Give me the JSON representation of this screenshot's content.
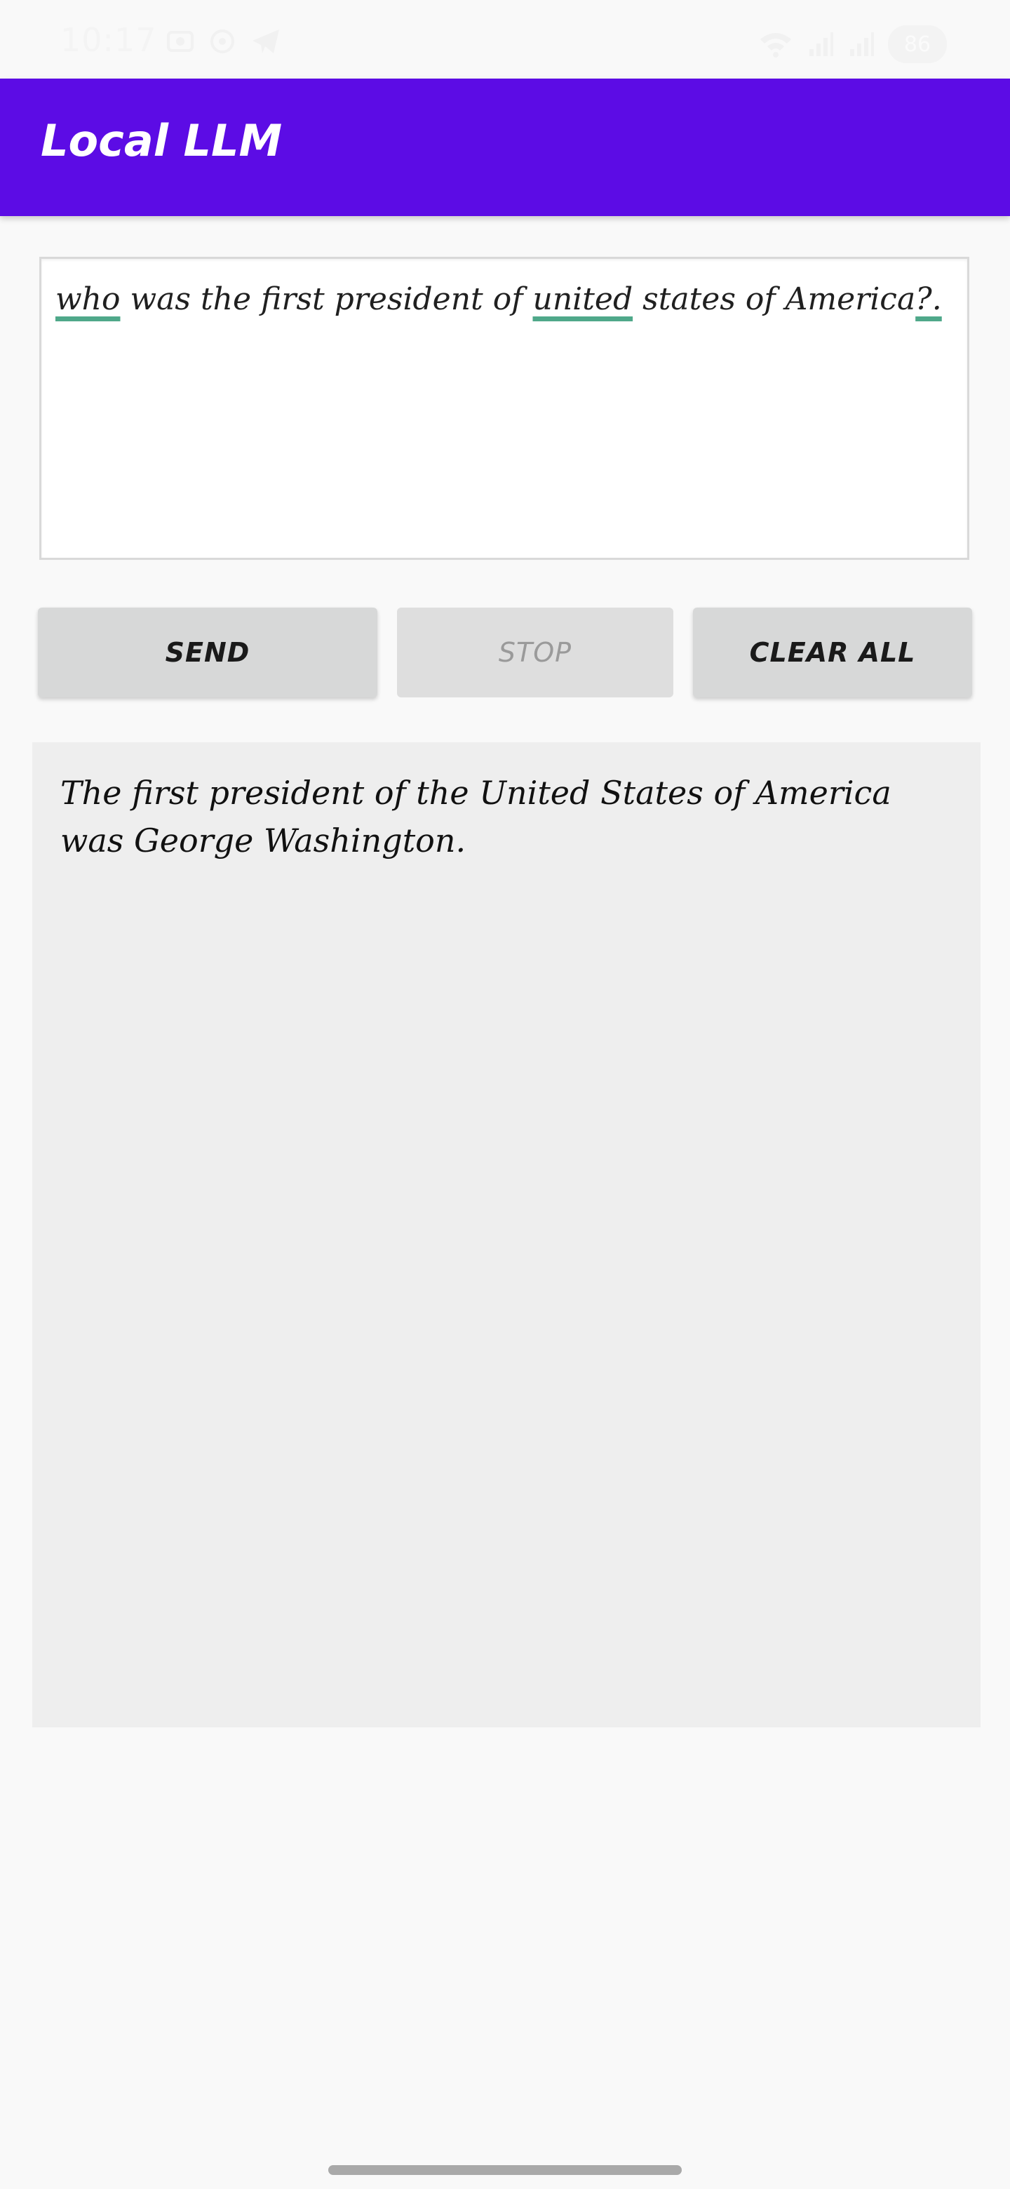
{
  "status_bar": {
    "time": "10:17",
    "left_icons": [
      "screenshot-icon",
      "settings-icon",
      "telegram-icon"
    ],
    "right_icons": [
      "wifi-icon",
      "signal-icon",
      "signal-icon"
    ],
    "battery": "86"
  },
  "app_bar": {
    "title": "Local LLM",
    "color": "#5c0ce5"
  },
  "prompt": {
    "segments": [
      {
        "text": "who",
        "spell_flag": true
      },
      {
        "text": " was the first president of ",
        "spell_flag": false
      },
      {
        "text": "united",
        "spell_flag": true
      },
      {
        "text": " states of America",
        "spell_flag": false
      },
      {
        "text": "?.",
        "spell_flag": true
      }
    ]
  },
  "buttons": {
    "send": "SEND",
    "stop": "STOP",
    "clear_all": "CLEAR ALL"
  },
  "response": {
    "text": "The first president of the United States of America was George Washington."
  }
}
